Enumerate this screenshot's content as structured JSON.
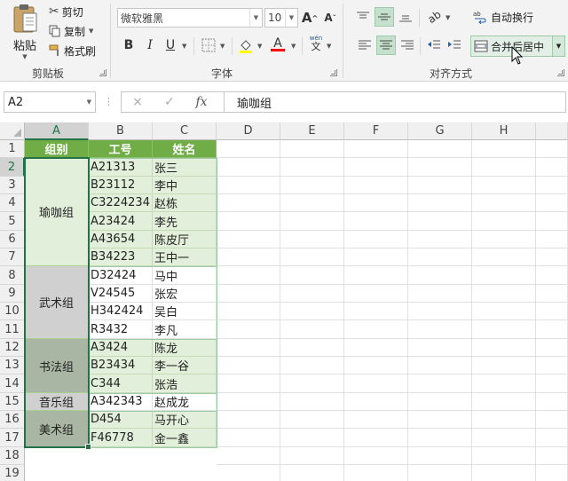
{
  "ribbon": {
    "clipboard": {
      "paste_label": "粘贴",
      "cut_label": "剪切",
      "copy_label": "复制",
      "format_painter_label": "格式刷",
      "group_label": "剪贴板"
    },
    "font": {
      "font_name": "微软雅黑",
      "font_size": "10",
      "grow_label": "A",
      "shrink_label": "A",
      "bold_label": "B",
      "italic_label": "I",
      "underline_label": "U",
      "font_color_label": "A",
      "phonetic_top": "wén",
      "phonetic_bottom": "文",
      "group_label": "字体"
    },
    "alignment": {
      "wrap_text_label": "自动换行",
      "merge_center_label": "合并后居中",
      "group_label": "对齐方式"
    }
  },
  "formula_bar": {
    "name_box": "A2",
    "cancel_icon": "×",
    "enter_icon": "✓",
    "fx_label": "fx",
    "formula_value": "瑜咖组"
  },
  "sheet": {
    "columns": [
      "A",
      "B",
      "C",
      "D",
      "E",
      "F",
      "G",
      "H"
    ],
    "rows": [
      "1",
      "2",
      "3",
      "4",
      "5",
      "6",
      "7",
      "8",
      "9",
      "10",
      "11",
      "12",
      "13",
      "14",
      "15",
      "16",
      "17",
      "18",
      "19"
    ],
    "header": [
      "组别",
      "工号",
      "姓名"
    ],
    "groups": [
      {
        "name": "瑜咖组",
        "color": "#e2efda"
      },
      {
        "name": "武术组",
        "color": "#d0d0d0"
      },
      {
        "name": "书法组",
        "color": "#a9b6a3"
      },
      {
        "name": "音乐组",
        "color": "#d0d0d0"
      },
      {
        "name": "美术组",
        "color": "#a9b6a3"
      }
    ],
    "records": [
      {
        "id": "A21313",
        "name": "张三"
      },
      {
        "id": "B23112",
        "name": "李中"
      },
      {
        "id": "C3224234",
        "name": "赵栋"
      },
      {
        "id": "A23424",
        "name": "李先"
      },
      {
        "id": "A43654",
        "name": "陈皮厅"
      },
      {
        "id": "B34223",
        "name": "王中一"
      },
      {
        "id": "D32424",
        "name": "马中"
      },
      {
        "id": "V24545",
        "name": "张宏"
      },
      {
        "id": "H342424",
        "name": "吴白"
      },
      {
        "id": "R3432",
        "name": "李凡"
      },
      {
        "id": "A3424",
        "name": "陈龙"
      },
      {
        "id": "B23434",
        "name": "李一谷"
      },
      {
        "id": "C344",
        "name": "张浩"
      },
      {
        "id": "A342343",
        "name": "赵成龙"
      },
      {
        "id": "D454",
        "name": "马开心"
      },
      {
        "id": "F46778",
        "name": "金一鑫"
      }
    ]
  },
  "colors": {
    "header_green": "#70ad47",
    "selection_green": "#217346",
    "accent_light_green": "#e2efda"
  }
}
